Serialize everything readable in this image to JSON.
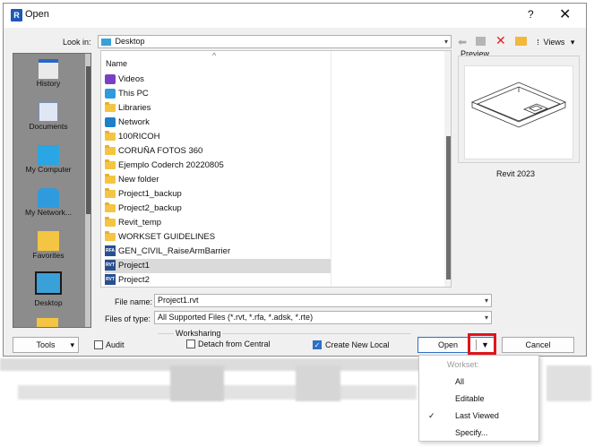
{
  "dialog": {
    "title": "Open",
    "help_glyph": "?",
    "close_glyph": "✕",
    "app_icon_text": "R"
  },
  "lookin": {
    "label": "Look in:",
    "value": "Desktop",
    "views_label": "Views"
  },
  "places": [
    {
      "label": "History"
    },
    {
      "label": "Documents"
    },
    {
      "label": "My Computer"
    },
    {
      "label": "My Network..."
    },
    {
      "label": "Favorites"
    },
    {
      "label": "Desktop"
    }
  ],
  "filelist": {
    "column_header": "Name",
    "sort_glyph": "^",
    "rows": [
      {
        "name": "Videos",
        "icon": "videos-icon"
      },
      {
        "name": "This PC",
        "icon": "this-pc-icon"
      },
      {
        "name": "Libraries",
        "icon": "folder-icon"
      },
      {
        "name": "Network",
        "icon": "network-icon"
      },
      {
        "name": "100RICOH",
        "icon": "folder-icon"
      },
      {
        "name": "CORUÑA FOTOS 360",
        "icon": "folder-icon"
      },
      {
        "name": "Ejemplo Coderch 20220805",
        "icon": "folder-icon"
      },
      {
        "name": "New folder",
        "icon": "folder-icon"
      },
      {
        "name": "Project1_backup",
        "icon": "folder-icon"
      },
      {
        "name": "Project2_backup",
        "icon": "folder-icon"
      },
      {
        "name": "Revit_temp",
        "icon": "folder-icon"
      },
      {
        "name": "WORKSET GUIDELINES",
        "icon": "folder-icon"
      },
      {
        "name": "GEN_CIVIL_RaiseArmBarrier",
        "icon": "rfa-file-icon"
      },
      {
        "name": "Project1",
        "icon": "rvt-file-icon",
        "selected": true
      },
      {
        "name": "Project2",
        "icon": "rvt-file-icon"
      }
    ]
  },
  "preview": {
    "label": "Preview",
    "caption": "Revit 2023"
  },
  "filename": {
    "label": "File name:",
    "value": "Project1.rvt"
  },
  "filetype": {
    "label": "Files of type:",
    "value": "All Supported Files  (*.rvt, *.rfa, *.adsk, *.rte)"
  },
  "bottom": {
    "tools_label": "Tools",
    "audit_label": "Audit",
    "worksharing_label": "Worksharing",
    "detach_label": "Detach from Central",
    "create_local_label": "Create New Local",
    "open_label": "Open",
    "cancel_label": "Cancel"
  },
  "menu": {
    "header": "Workset:",
    "items": [
      {
        "label": "All",
        "checked": false
      },
      {
        "label": "Editable",
        "checked": false
      },
      {
        "label": "Last Viewed",
        "checked": true
      },
      {
        "label": "Specify...",
        "checked": false
      }
    ],
    "check_glyph": "✓"
  },
  "colors": {
    "selection": "#dadada",
    "highlight_box": "#e0151b",
    "accent": "#2f6fc4"
  }
}
